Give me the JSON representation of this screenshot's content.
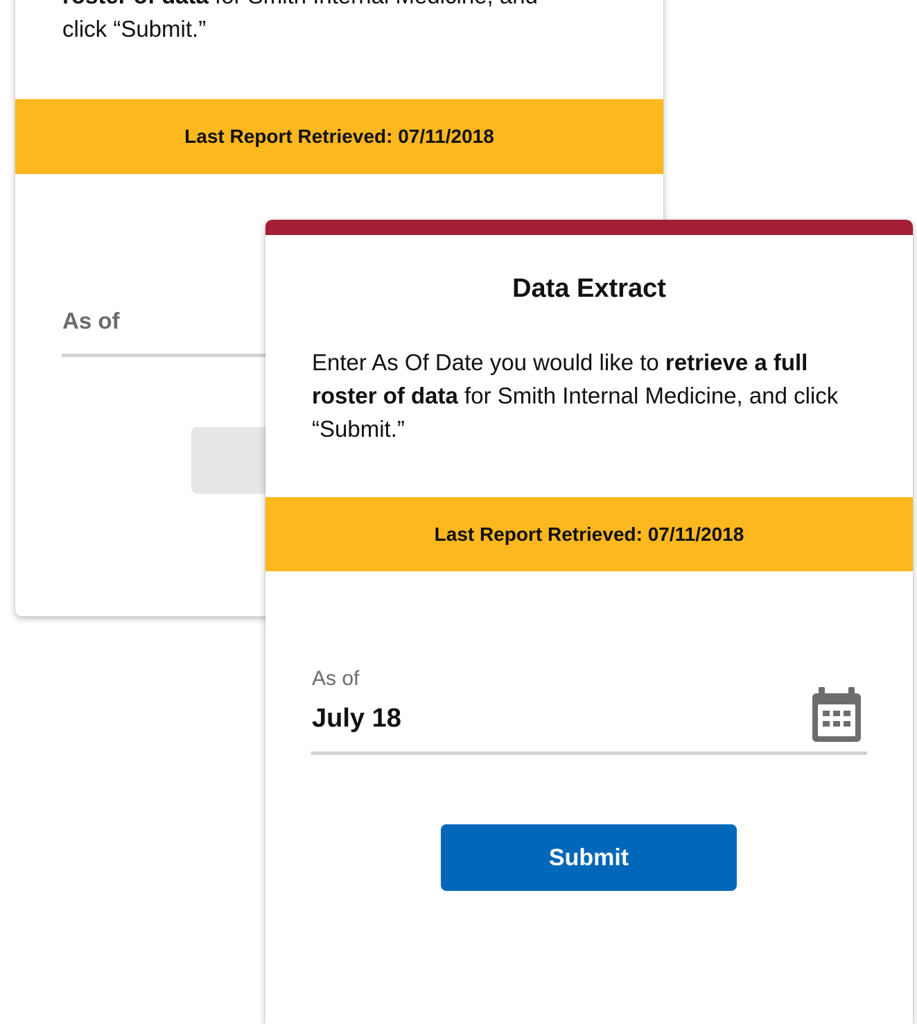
{
  "colors": {
    "accent_bar": "#a31f34",
    "banner": "#fdb71f",
    "button": "#0067b9",
    "muted_text": "#6b6b6b",
    "underline": "#d2d2d2"
  },
  "back_card": {
    "description": {
      "line1_bold": "roster of data",
      "line1_rest": " for Smith Internal Medicine, and",
      "line2": "click “Submit.”"
    },
    "banner_text": "Last Report Retrieved: 07/11/2018",
    "as_of_label": "As of"
  },
  "front_card": {
    "title": "Data Extract",
    "description": {
      "part1": "Enter As Of Date you would like to ",
      "bold": "retrieve a full roster of data",
      "part2": " for Smith Internal Medicine, and click “Submit.”"
    },
    "banner_text": "Last Report Retrieved: 07/11/2018",
    "as_of_label": "As of",
    "as_of_value": "July 18",
    "calendar_icon": "calendar-icon",
    "submit_label": "Submit"
  }
}
